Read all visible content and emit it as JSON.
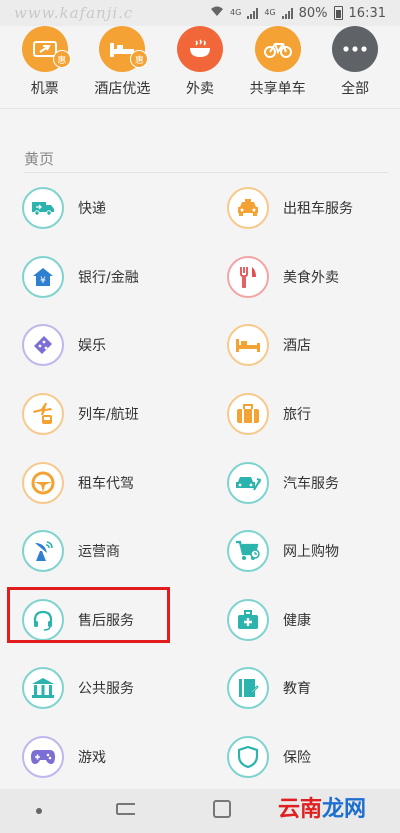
{
  "status_bar": {
    "watermark_text": "www.kafanji.c",
    "battery": "80%",
    "time": "16:31",
    "net1": "4G",
    "net2": "4G"
  },
  "top_items": [
    {
      "label": "机票",
      "icon": "plane-ticket-icon",
      "color": "#f4a233",
      "badge": "惠"
    },
    {
      "label": "酒店优选",
      "icon": "hotel-bed-icon",
      "color": "#f4a233",
      "badge": "惠"
    },
    {
      "label": "外卖",
      "icon": "bowl-icon",
      "color": "#f2673a"
    },
    {
      "label": "共享单车",
      "icon": "bicycle-icon",
      "color": "#f4a233"
    },
    {
      "label": "全部",
      "icon": "more-icon",
      "color": "#5f6368"
    }
  ],
  "section": {
    "title": "黄页"
  },
  "services": [
    [
      {
        "label": "快递",
        "icon": "delivery-truck-icon",
        "tone": "teal"
      },
      {
        "label": "出租车服务",
        "icon": "taxi-icon",
        "tone": "orange"
      }
    ],
    [
      {
        "label": "银行/金融",
        "icon": "bank-house-icon",
        "tone": "teal"
      },
      {
        "label": "美食外卖",
        "icon": "fork-knife-icon",
        "tone": "red"
      }
    ],
    [
      {
        "label": "娱乐",
        "icon": "ticket-icon",
        "tone": "purple"
      },
      {
        "label": "酒店",
        "icon": "bed-icon",
        "tone": "orange"
      }
    ],
    [
      {
        "label": "列车/航班",
        "icon": "train-plane-icon",
        "tone": "orange"
      },
      {
        "label": "旅行",
        "icon": "suitcase-icon",
        "tone": "orange"
      }
    ],
    [
      {
        "label": "租车代驾",
        "icon": "steering-wheel-icon",
        "tone": "orange"
      },
      {
        "label": "汽车服务",
        "icon": "car-service-icon",
        "tone": "teal"
      }
    ],
    [
      {
        "label": "运营商",
        "icon": "antenna-icon",
        "tone": "teal"
      },
      {
        "label": "网上购物",
        "icon": "shopping-cart-icon",
        "tone": "teal"
      }
    ],
    [
      {
        "label": "售后服务",
        "icon": "headset-icon",
        "tone": "teal"
      },
      {
        "label": "健康",
        "icon": "medical-kit-icon",
        "tone": "teal"
      }
    ],
    [
      {
        "label": "公共服务",
        "icon": "public-building-icon",
        "tone": "teal"
      },
      {
        "label": "教育",
        "icon": "book-icon",
        "tone": "teal"
      }
    ],
    [
      {
        "label": "游戏",
        "icon": "gamepad-icon",
        "tone": "purple"
      },
      {
        "label": "保险",
        "icon": "shield-icon",
        "tone": "teal"
      }
    ]
  ],
  "brand_watermark": {
    "part1": "云南",
    "part2": "龙网"
  },
  "colors": {
    "teal": "#2bb3ad",
    "orange": "#f4a233",
    "red": "#e45050",
    "purple": "#7b6fd6",
    "highlight": "#e21c1c"
  }
}
